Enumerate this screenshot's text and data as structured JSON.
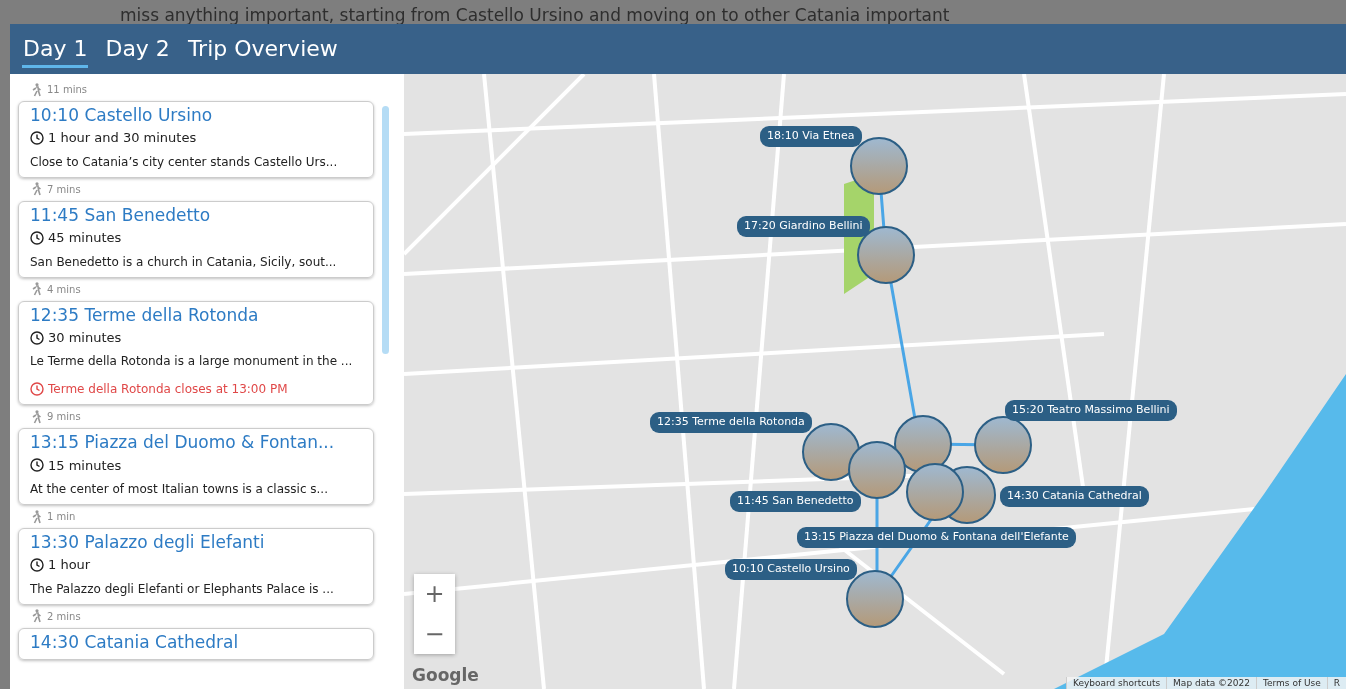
{
  "background_text": "miss anything important, starting from Castello Ursino and moving on to other Catania important",
  "tabs": [
    {
      "label": "Day 1",
      "selected": true
    },
    {
      "label": "Day 2",
      "selected": false
    },
    {
      "label": "Trip Overview",
      "selected": false
    }
  ],
  "itinerary": [
    {
      "walk": "11 mins",
      "title": "10:10 Castello Ursino",
      "duration": "1 hour and 30 minutes",
      "description": "Close to Catania’s city center stands Castello Urs..."
    },
    {
      "walk": "7 mins",
      "title": "11:45 San Benedetto",
      "duration": "45 minutes",
      "description": "San Benedetto is a church in Catania, Sicily, sout..."
    },
    {
      "walk": "4 mins",
      "title": "12:35 Terme della Rotonda",
      "duration": "30 minutes",
      "description": "Le Terme della Rotonda is a large monument in the ...",
      "warning": "Terme della Rotonda closes at 13:00 PM"
    },
    {
      "walk": "9 mins",
      "title": "13:15 Piazza del Duomo & Fontan...",
      "duration": "15 minutes",
      "description": "At the center of most Italian towns is a classic s..."
    },
    {
      "walk": "1 min",
      "title": "13:30 Palazzo degli Elefanti",
      "duration": "1 hour",
      "description": "The Palazzo degli Elefanti or Elephants Palace is ..."
    },
    {
      "walk": "2 mins",
      "title": "14:30 Catania Cathedral"
    }
  ],
  "map": {
    "markers": [
      {
        "kind": "labeled",
        "label": "18:10 Via Etnea"
      },
      {
        "kind": "labeled",
        "label": "17:20 Giardino Bellini"
      },
      {
        "kind": "labeled",
        "label": "12:35 Terme della Rotonda"
      },
      {
        "kind": "plain"
      },
      {
        "kind": "labeled",
        "label": "15:20 Teatro Massimo Bellini"
      },
      {
        "kind": "labeled",
        "label": "11:45 San Benedetto"
      },
      {
        "kind": "labeled",
        "label": "14:30 Catania Cathedral"
      },
      {
        "kind": "labeled",
        "label": "13:15 Piazza del Duomo & Fontana dell'Elefante"
      },
      {
        "kind": "labeled",
        "label": "10:10 Castello Ursino"
      }
    ],
    "zoom_in": "+",
    "zoom_out": "−",
    "logo": "Google",
    "attribution": [
      "Keyboard shortcuts",
      "Map data ©2022",
      "Terms of Use",
      "R"
    ]
  }
}
